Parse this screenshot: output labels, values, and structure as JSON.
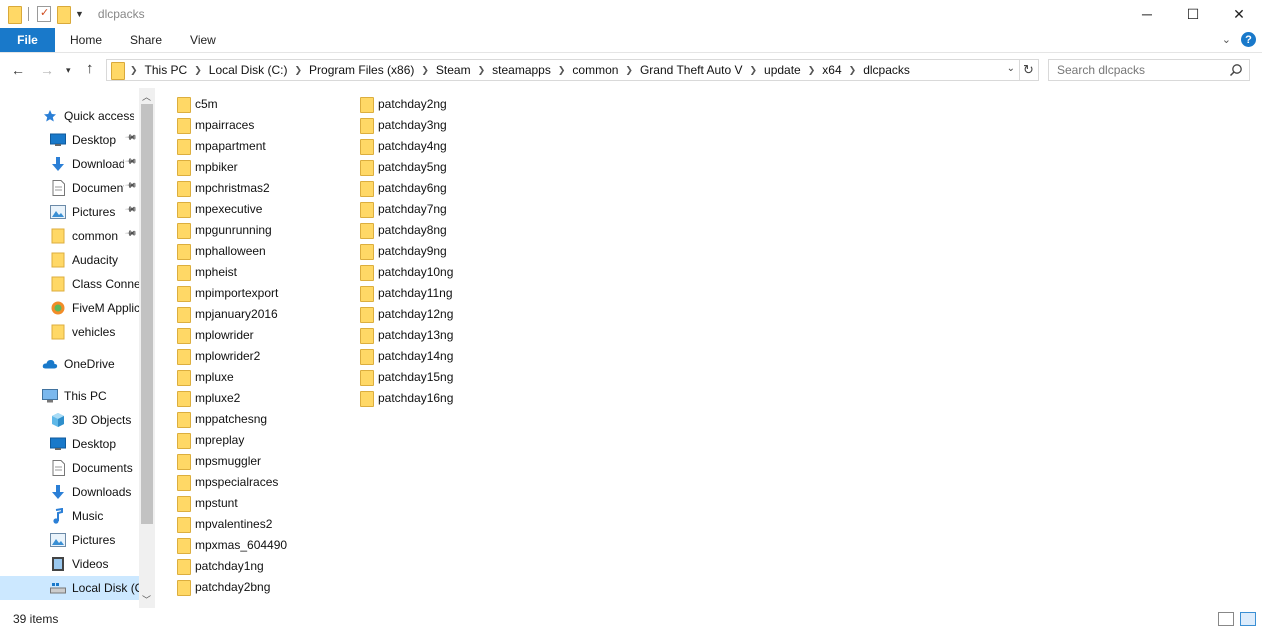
{
  "titlebar": {
    "title": "dlcpacks"
  },
  "ribbon": {
    "file": "File",
    "tabs": [
      "Home",
      "Share",
      "View"
    ]
  },
  "address": {
    "crumbs": [
      "This PC",
      "Local Disk (C:)",
      "Program Files (x86)",
      "Steam",
      "steamapps",
      "common",
      "Grand Theft Auto V",
      "update",
      "x64",
      "dlcpacks"
    ]
  },
  "search": {
    "placeholder": "Search dlcpacks"
  },
  "navpane": {
    "items": [
      {
        "label": "Quick access",
        "icon": "star-icon",
        "pinned": false,
        "indent": 0
      },
      {
        "label": "Desktop",
        "icon": "desktop-icon",
        "pinned": true,
        "indent": 1
      },
      {
        "label": "Downloads",
        "icon": "download-icon",
        "pinned": true,
        "indent": 1
      },
      {
        "label": "Documents",
        "icon": "document-icon",
        "pinned": true,
        "indent": 1
      },
      {
        "label": "Pictures",
        "icon": "pictures-icon",
        "pinned": true,
        "indent": 1
      },
      {
        "label": "common",
        "icon": "folder-icon",
        "pinned": true,
        "indent": 1
      },
      {
        "label": "Audacity",
        "icon": "folder-icon",
        "pinned": false,
        "indent": 1
      },
      {
        "label": "Class Connect",
        "icon": "folder-icon",
        "pinned": false,
        "indent": 1
      },
      {
        "label": "FiveM Application Data",
        "icon": "fivem-icon",
        "pinned": false,
        "indent": 1
      },
      {
        "label": "vehicles",
        "icon": "folder-icon",
        "pinned": false,
        "indent": 1
      },
      {
        "label": "OneDrive",
        "icon": "cloud-icon",
        "pinned": false,
        "indent": 0
      },
      {
        "label": "This PC",
        "icon": "computer-icon",
        "pinned": false,
        "indent": 0
      },
      {
        "label": "3D Objects",
        "icon": "cube-icon",
        "pinned": false,
        "indent": 1
      },
      {
        "label": "Desktop",
        "icon": "desktop-icon",
        "pinned": false,
        "indent": 1
      },
      {
        "label": "Documents",
        "icon": "document-icon",
        "pinned": false,
        "indent": 1
      },
      {
        "label": "Downloads",
        "icon": "download-icon",
        "pinned": false,
        "indent": 1
      },
      {
        "label": "Music",
        "icon": "music-icon",
        "pinned": false,
        "indent": 1
      },
      {
        "label": "Pictures",
        "icon": "pictures-icon",
        "pinned": false,
        "indent": 1
      },
      {
        "label": "Videos",
        "icon": "video-icon",
        "pinned": false,
        "indent": 1
      },
      {
        "label": "Local Disk (C:)",
        "icon": "drive-icon",
        "pinned": false,
        "indent": 1,
        "selected": true
      }
    ]
  },
  "files": {
    "column1": [
      "c5m",
      "mpairraces",
      "mpapartment",
      "mpbiker",
      "mpchristmas2",
      "mpexecutive",
      "mpgunrunning",
      "mphalloween",
      "mpheist",
      "mpimportexport",
      "mpjanuary2016",
      "mplowrider",
      "mplowrider2",
      "mpluxe",
      "mpluxe2",
      "mppatchesng",
      "mpreplay",
      "mpsmuggler",
      "mpspecialraces",
      "mpstunt",
      "mpvalentines2",
      "mpxmas_604490",
      "patchday1ng",
      "patchday2bng"
    ],
    "column2": [
      "patchday2ng",
      "patchday3ng",
      "patchday4ng",
      "patchday5ng",
      "patchday6ng",
      "patchday7ng",
      "patchday8ng",
      "patchday9ng",
      "patchday10ng",
      "patchday11ng",
      "patchday12ng",
      "patchday13ng",
      "patchday14ng",
      "patchday15ng",
      "patchday16ng"
    ]
  },
  "status": {
    "item_count": "39 items"
  },
  "colors": {
    "accent": "#1979ca",
    "selection": "#cce8ff",
    "folder": "#ffd866"
  }
}
